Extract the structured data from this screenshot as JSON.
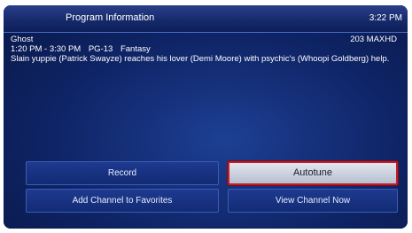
{
  "header": {
    "title": "Program Information",
    "time": "3:22 PM"
  },
  "program": {
    "name": "Ghost",
    "channel": "203 MAXHD",
    "time_range": "1:20 PM - 3:30 PM",
    "rating": "PG-13",
    "genre": "Fantasy",
    "description": "Slain yuppie (Patrick Swayze) reaches his lover (Demi Moore) with psychic's (Whoopi Goldberg) help."
  },
  "buttons": {
    "record": "Record",
    "autotune": "Autotune",
    "add_favorites": "Add Channel to Favorites",
    "view_now": "View Channel Now"
  },
  "colors": {
    "background": "#0f2466",
    "selected_border": "#c01c2c"
  }
}
